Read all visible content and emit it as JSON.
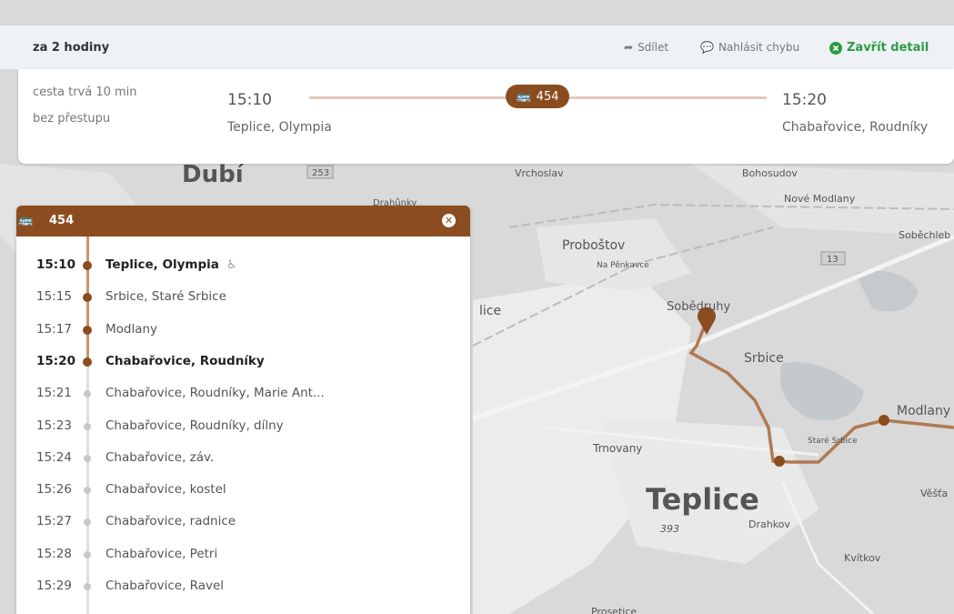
{
  "header": {
    "title": "za 2 hodiny",
    "share_label": "Sdílet",
    "report_label": "Nahlásit chybu",
    "close_label": "Zavřít detail"
  },
  "trip": {
    "duration": "cesta trvá 10 min",
    "transfers": "bez přestupu",
    "departure_time": "15:10",
    "departure_stop": "Teplice, Olympia",
    "arrival_time": "15:20",
    "arrival_stop": "Chabařovice, Roudníky",
    "line": "454"
  },
  "panel": {
    "line": "454",
    "stops": [
      {
        "time": "15:10",
        "name": "Teplice, Olympia",
        "bold": true,
        "on_route": true,
        "accessible": true
      },
      {
        "time": "15:15",
        "name": "Srbice, Staré Srbice",
        "bold": false,
        "on_route": true
      },
      {
        "time": "15:17",
        "name": "Modlany",
        "bold": false,
        "on_route": true
      },
      {
        "time": "15:20",
        "name": "Chabařovice, Roudníky",
        "bold": true,
        "on_route": true
      },
      {
        "time": "15:21",
        "name": "Chabařovice, Roudníky, Marie Ant...",
        "bold": false,
        "on_route": false
      },
      {
        "time": "15:23",
        "name": "Chabařovice, Roudníky, dílny",
        "bold": false,
        "on_route": false
      },
      {
        "time": "15:24",
        "name": "Chabařovice, záv.",
        "bold": false,
        "on_route": false
      },
      {
        "time": "15:26",
        "name": "Chabařovice, kostel",
        "bold": false,
        "on_route": false
      },
      {
        "time": "15:27",
        "name": "Chabařovice, radnice",
        "bold": false,
        "on_route": false
      },
      {
        "time": "15:28",
        "name": "Chabařovice, Petri",
        "bold": false,
        "on_route": false
      },
      {
        "time": "15:29",
        "name": "Chabařovice, Ravel",
        "bold": false,
        "on_route": false
      }
    ]
  },
  "map": {
    "labels": {
      "dubi": "Dubí",
      "road_253": "253",
      "drahunky": "Drahůnky",
      "vrchoslav": "Vrchoslav",
      "bohosudov": "Bohosudov",
      "nove_modlany": "Nové Modlany",
      "sobechleby": "Soběchleb",
      "probostov": "Proboštov",
      "na_penkavce": "Na Pěnkavce",
      "road_13": "13",
      "sobedruhy": "Sobědruhy",
      "lice": "lice",
      "srbice": "Srbice",
      "modlany": "Modlany",
      "stare_srbice": "Staré Srbice",
      "trnovany": "Trnovany",
      "teplice": "Teplice",
      "vestan": "Věšťa",
      "elevation_393": "393",
      "drahkov": "Drahkov",
      "kvitkov": "Kvítkov",
      "prosetice": "Prosetice"
    },
    "route_color": "#8b4d1f"
  },
  "colors": {
    "brand": "#8b4d1f",
    "close_green": "#2e9a46"
  }
}
